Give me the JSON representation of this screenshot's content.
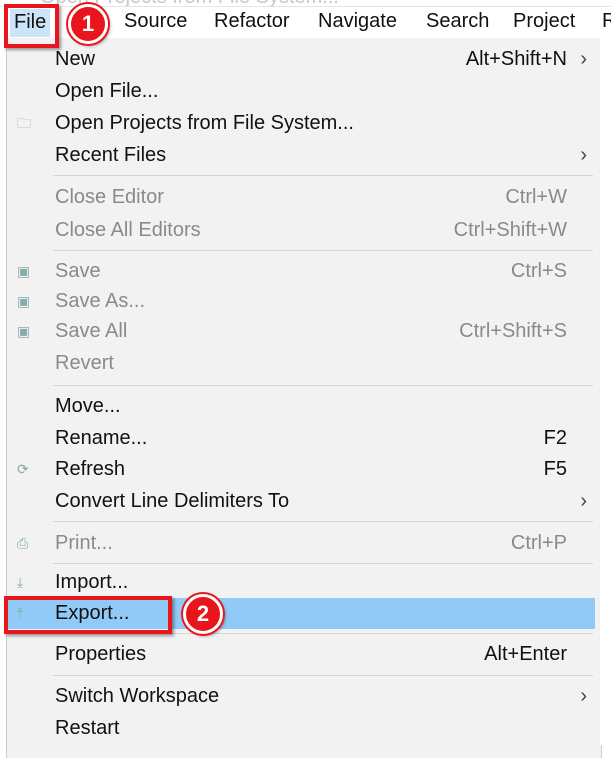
{
  "background_hint": "Open Projects from File System...",
  "menubar": [
    "File",
    "Source",
    "Refactor",
    "Navigate",
    "Search",
    "Project",
    "R"
  ],
  "menu": [
    {
      "label": "New",
      "shortcut": "Alt+Shift+N",
      "submenu": true,
      "enabled": true
    },
    {
      "label": "Open File...",
      "enabled": true
    },
    {
      "label": "Open Projects from File System...",
      "enabled": true,
      "icon": "folder-icon"
    },
    {
      "label": "Recent Files",
      "submenu": true,
      "enabled": true
    },
    {
      "label": "Close Editor",
      "shortcut": "Ctrl+W",
      "enabled": false
    },
    {
      "label": "Close All Editors",
      "shortcut": "Ctrl+Shift+W",
      "enabled": false
    },
    {
      "label": "Save",
      "shortcut": "Ctrl+S",
      "enabled": false,
      "icon": "save-icon"
    },
    {
      "label": "Save As...",
      "enabled": false,
      "icon": "save-as-icon"
    },
    {
      "label": "Save All",
      "shortcut": "Ctrl+Shift+S",
      "enabled": false,
      "icon": "save-all-icon"
    },
    {
      "label": "Revert",
      "enabled": false
    },
    {
      "label": "Move...",
      "enabled": true
    },
    {
      "label": "Rename...",
      "shortcut": "F2",
      "enabled": true
    },
    {
      "label": "Refresh",
      "shortcut": "F5",
      "enabled": true,
      "icon": "refresh-icon"
    },
    {
      "label": "Convert Line Delimiters To",
      "submenu": true,
      "enabled": true
    },
    {
      "label": "Print...",
      "shortcut": "Ctrl+P",
      "enabled": false,
      "icon": "print-icon"
    },
    {
      "label": "Import...",
      "enabled": true,
      "icon": "import-icon"
    },
    {
      "label": "Export...",
      "enabled": true,
      "icon": "export-icon",
      "highlighted": true
    },
    {
      "label": "Properties",
      "shortcut": "Alt+Enter",
      "enabled": true
    },
    {
      "label": "Switch Workspace",
      "submenu": true,
      "enabled": true
    },
    {
      "label": "Restart",
      "enabled": true
    }
  ],
  "annotations": {
    "step1": "1",
    "step2": "2",
    "color": "#e8161c"
  },
  "highlight_color": "#91c9f7"
}
